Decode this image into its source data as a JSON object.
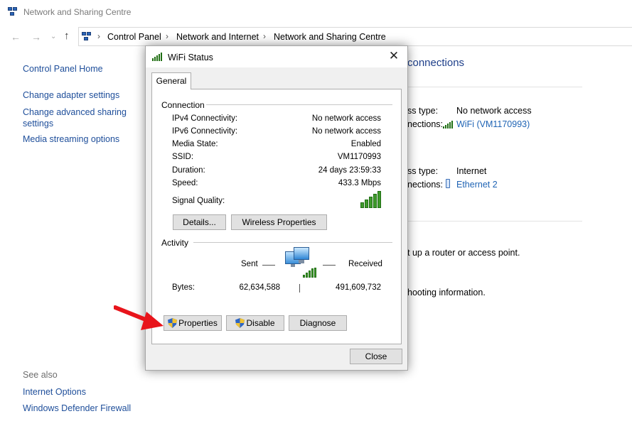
{
  "window": {
    "title": "Network and Sharing Centre"
  },
  "address": {
    "crumbs": [
      "Control Panel",
      "Network and Internet",
      "Network and Sharing Centre"
    ]
  },
  "left_pane": {
    "links": [
      "Control Panel Home",
      "Change adapter settings",
      "Change advanced sharing settings",
      "Media streaming options"
    ],
    "see_also_heading": "See also",
    "see_also_links": [
      "Internet Options",
      "Windows Defender Firewall"
    ]
  },
  "main": {
    "heading_fragment": "connections",
    "net1": {
      "access_label": "ss type:",
      "access_value": "No network access",
      "conn_label": "nections:",
      "conn_value": "WiFi (VM1170993)"
    },
    "net2": {
      "access_label": "ss type:",
      "access_value": "Internet",
      "conn_label": "nections:",
      "conn_value": "Ethernet 2"
    },
    "text1": "t up a router or access point.",
    "text2": "hooting information."
  },
  "dialog": {
    "title": "WiFi Status",
    "close_glyph": "✕",
    "tab": "General",
    "connection": {
      "heading": "Connection",
      "rows": [
        {
          "label": "IPv4 Connectivity:",
          "value": "No network access"
        },
        {
          "label": "IPv6 Connectivity:",
          "value": "No network access"
        },
        {
          "label": "Media State:",
          "value": "Enabled"
        },
        {
          "label": "SSID:",
          "value": "VM1170993"
        },
        {
          "label": "Duration:",
          "value": "24 days 23:59:33"
        },
        {
          "label": "Speed:",
          "value": "433.3 Mbps"
        }
      ],
      "signal_label": "Signal Quality:",
      "signal_bars": 5,
      "details_button": "Details...",
      "wireless_button": "Wireless Properties"
    },
    "activity": {
      "heading": "Activity",
      "sent_label": "Sent",
      "received_label": "Received",
      "bytes_label": "Bytes:",
      "bytes_sent": "62,634,588",
      "bytes_received": "491,609,732"
    },
    "buttons": {
      "properties": "Properties",
      "disable": "Disable",
      "diagnose": "Diagnose",
      "close": "Close"
    }
  },
  "colors": {
    "link": "#1e4e9a",
    "signal": "#3f9a2c",
    "arrow": "#e8141b"
  }
}
